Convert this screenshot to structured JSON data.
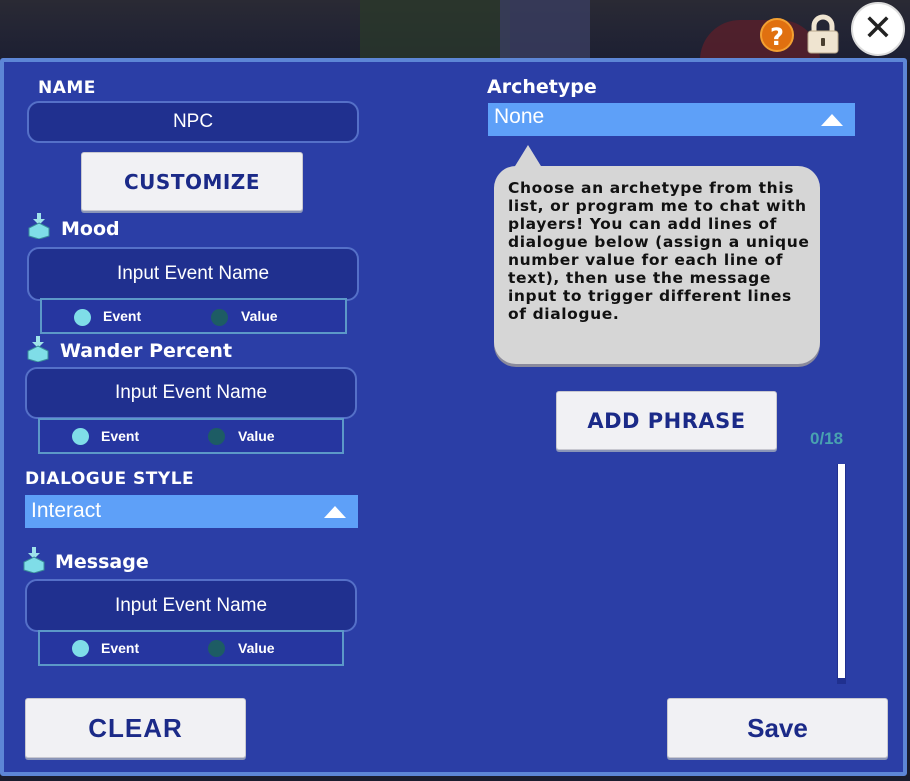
{
  "window": {
    "help_icon": "question-mark",
    "lock_icon": "padlock",
    "close_icon": "X"
  },
  "name_section": {
    "title": "NAME",
    "value": "NPC",
    "customize_label": "CUSTOMIZE"
  },
  "mood": {
    "title": "Mood",
    "input_placeholder": "Input Event Name",
    "toggle": {
      "event": "Event",
      "value": "Value",
      "selected": "Event"
    }
  },
  "wander": {
    "title": "Wander Percent",
    "input_placeholder": "Input Event Name",
    "toggle": {
      "event": "Event",
      "value": "Value",
      "selected": "Event"
    }
  },
  "dialogue_style": {
    "title": "DIALOGUE STYLE",
    "selected": "Interact"
  },
  "message": {
    "title": "Message",
    "input_placeholder": "Input Event Name",
    "toggle": {
      "event": "Event",
      "value": "Value",
      "selected": "Event"
    }
  },
  "archetype": {
    "title": "Archetype",
    "selected": "None",
    "help_text": "Choose an archetype from this list, or program me to chat with players! You can add lines of dialogue below (assign a unique number value for each line of text), then use the message input to trigger different lines of dialogue."
  },
  "phrases": {
    "add_label": "ADD PHRASE",
    "count": "0/18"
  },
  "footer": {
    "clear_label": "CLEAR",
    "save_label": "Save"
  },
  "colors": {
    "panel": "#2b3ea6",
    "panel_border": "#5d86d6",
    "field": "#20308f",
    "dropdown": "#5ea0f8",
    "toggle_on": "#7fdde8",
    "toggle_off": "#1d5c64",
    "button_text": "#1b2a88"
  }
}
